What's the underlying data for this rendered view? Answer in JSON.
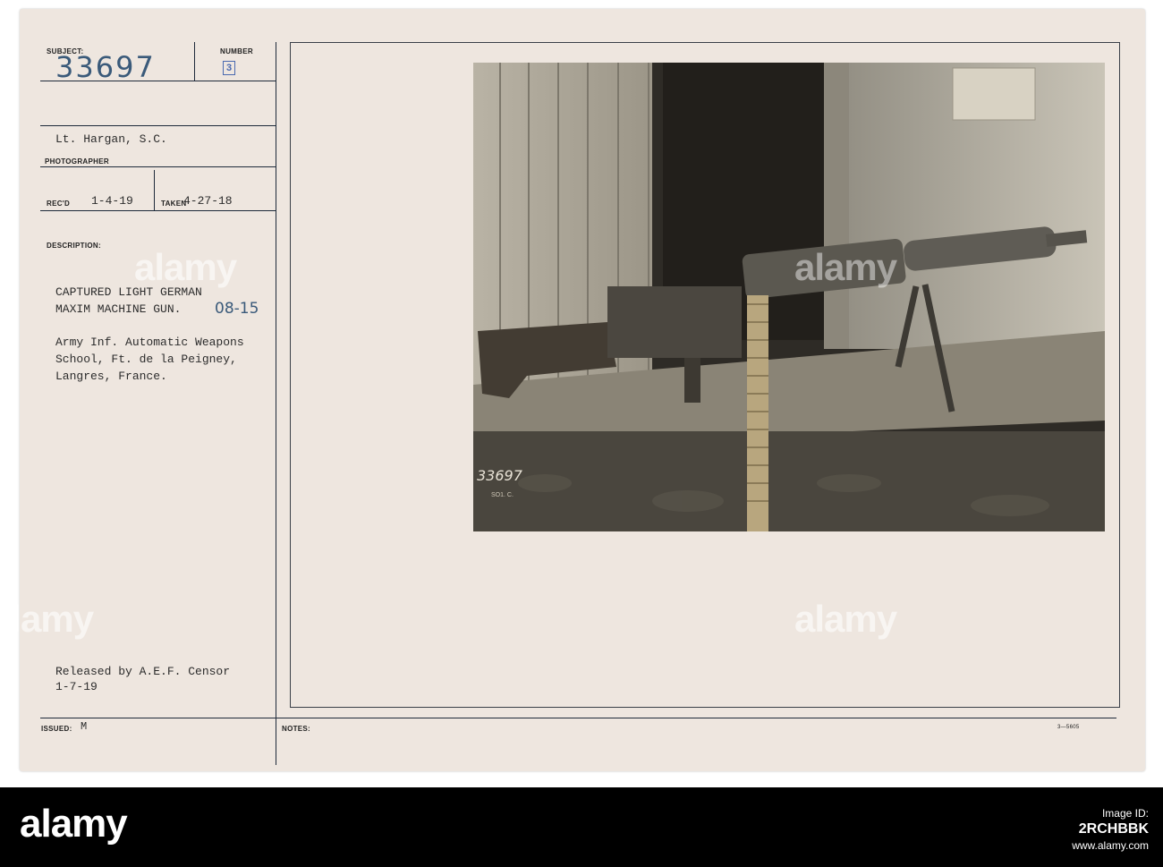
{
  "card": {
    "subject_label": "SUBJECT:",
    "subject_number": "33697",
    "number_label": "NUMBER",
    "number_mark": "3",
    "photographer_name": "Lt. Hargan, S.C.",
    "photographer_label": "PHOTOGRAPHER",
    "recd_label": "REC'D",
    "recd_date": "1-4-19",
    "taken_label": "TAKEN",
    "taken_date": "4-27-18",
    "description_label": "DESCRIPTION:",
    "description_line1": "CAPTURED LIGHT GERMAN",
    "description_line2": "MAXIM MACHINE GUN.",
    "model_handwritten": "08-15",
    "location_line1": "Army Inf. Automatic Weapons",
    "location_line2": "School, Ft. de la Peigney,",
    "location_line3": "Langres, France.",
    "release_line1": "Released by A.E.F. Censor",
    "release_line2": "1-7-19",
    "issued_label": "ISSUED:",
    "issued_mark": "M",
    "notes_label": "NOTES:",
    "form_number": "3—5605"
  },
  "photo": {
    "negative_number": "33697",
    "stamp_text": "SO1. C."
  },
  "watermarks": {
    "text": "alamy"
  },
  "footer": {
    "logo": "alamy",
    "image_id_label": "Image ID:",
    "image_id": "2RCHBBK",
    "site": "www.alamy.com"
  },
  "colors": {
    "card": "#eee6df",
    "ink_lines": "#1e2a3a",
    "handwriting": "#3a5a7a",
    "footer": "#000000"
  }
}
